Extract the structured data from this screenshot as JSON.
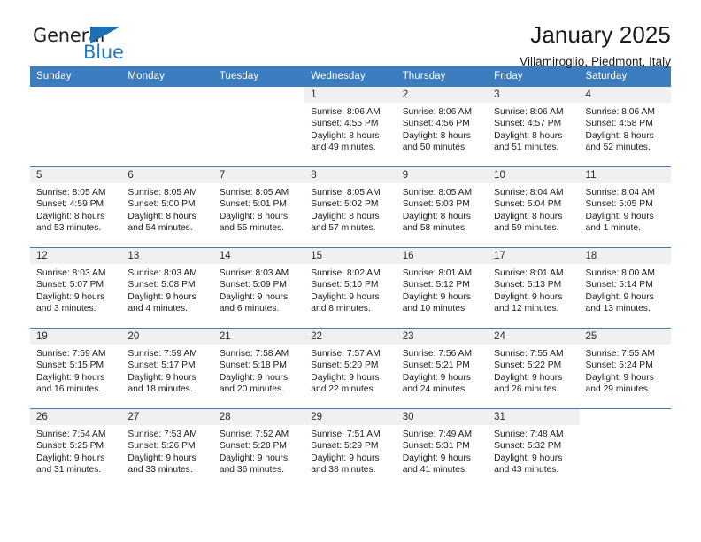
{
  "brand": {
    "name_dark": "General",
    "name_blue": "Blue",
    "accent_color": "#1f6fb5"
  },
  "header": {
    "title": "January 2025",
    "subtitle": "Villamiroglio, Piedmont, Italy"
  },
  "calendar": {
    "header_bg": "#3b7dbf",
    "daynum_bg": "#f0f0f0",
    "weekday_headers": [
      "Sunday",
      "Monday",
      "Tuesday",
      "Wednesday",
      "Thursday",
      "Friday",
      "Saturday"
    ],
    "weeks": [
      [
        {
          "day": "",
          "sunrise": "",
          "sunset": "",
          "daylight_1": "",
          "daylight_2": ""
        },
        {
          "day": "",
          "sunrise": "",
          "sunset": "",
          "daylight_1": "",
          "daylight_2": ""
        },
        {
          "day": "",
          "sunrise": "",
          "sunset": "",
          "daylight_1": "",
          "daylight_2": ""
        },
        {
          "day": "1",
          "sunrise": "Sunrise: 8:06 AM",
          "sunset": "Sunset: 4:55 PM",
          "daylight_1": "Daylight: 8 hours",
          "daylight_2": "and 49 minutes."
        },
        {
          "day": "2",
          "sunrise": "Sunrise: 8:06 AM",
          "sunset": "Sunset: 4:56 PM",
          "daylight_1": "Daylight: 8 hours",
          "daylight_2": "and 50 minutes."
        },
        {
          "day": "3",
          "sunrise": "Sunrise: 8:06 AM",
          "sunset": "Sunset: 4:57 PM",
          "daylight_1": "Daylight: 8 hours",
          "daylight_2": "and 51 minutes."
        },
        {
          "day": "4",
          "sunrise": "Sunrise: 8:06 AM",
          "sunset": "Sunset: 4:58 PM",
          "daylight_1": "Daylight: 8 hours",
          "daylight_2": "and 52 minutes."
        }
      ],
      [
        {
          "day": "5",
          "sunrise": "Sunrise: 8:05 AM",
          "sunset": "Sunset: 4:59 PM",
          "daylight_1": "Daylight: 8 hours",
          "daylight_2": "and 53 minutes."
        },
        {
          "day": "6",
          "sunrise": "Sunrise: 8:05 AM",
          "sunset": "Sunset: 5:00 PM",
          "daylight_1": "Daylight: 8 hours",
          "daylight_2": "and 54 minutes."
        },
        {
          "day": "7",
          "sunrise": "Sunrise: 8:05 AM",
          "sunset": "Sunset: 5:01 PM",
          "daylight_1": "Daylight: 8 hours",
          "daylight_2": "and 55 minutes."
        },
        {
          "day": "8",
          "sunrise": "Sunrise: 8:05 AM",
          "sunset": "Sunset: 5:02 PM",
          "daylight_1": "Daylight: 8 hours",
          "daylight_2": "and 57 minutes."
        },
        {
          "day": "9",
          "sunrise": "Sunrise: 8:05 AM",
          "sunset": "Sunset: 5:03 PM",
          "daylight_1": "Daylight: 8 hours",
          "daylight_2": "and 58 minutes."
        },
        {
          "day": "10",
          "sunrise": "Sunrise: 8:04 AM",
          "sunset": "Sunset: 5:04 PM",
          "daylight_1": "Daylight: 8 hours",
          "daylight_2": "and 59 minutes."
        },
        {
          "day": "11",
          "sunrise": "Sunrise: 8:04 AM",
          "sunset": "Sunset: 5:05 PM",
          "daylight_1": "Daylight: 9 hours",
          "daylight_2": "and 1 minute."
        }
      ],
      [
        {
          "day": "12",
          "sunrise": "Sunrise: 8:03 AM",
          "sunset": "Sunset: 5:07 PM",
          "daylight_1": "Daylight: 9 hours",
          "daylight_2": "and 3 minutes."
        },
        {
          "day": "13",
          "sunrise": "Sunrise: 8:03 AM",
          "sunset": "Sunset: 5:08 PM",
          "daylight_1": "Daylight: 9 hours",
          "daylight_2": "and 4 minutes."
        },
        {
          "day": "14",
          "sunrise": "Sunrise: 8:03 AM",
          "sunset": "Sunset: 5:09 PM",
          "daylight_1": "Daylight: 9 hours",
          "daylight_2": "and 6 minutes."
        },
        {
          "day": "15",
          "sunrise": "Sunrise: 8:02 AM",
          "sunset": "Sunset: 5:10 PM",
          "daylight_1": "Daylight: 9 hours",
          "daylight_2": "and 8 minutes."
        },
        {
          "day": "16",
          "sunrise": "Sunrise: 8:01 AM",
          "sunset": "Sunset: 5:12 PM",
          "daylight_1": "Daylight: 9 hours",
          "daylight_2": "and 10 minutes."
        },
        {
          "day": "17",
          "sunrise": "Sunrise: 8:01 AM",
          "sunset": "Sunset: 5:13 PM",
          "daylight_1": "Daylight: 9 hours",
          "daylight_2": "and 12 minutes."
        },
        {
          "day": "18",
          "sunrise": "Sunrise: 8:00 AM",
          "sunset": "Sunset: 5:14 PM",
          "daylight_1": "Daylight: 9 hours",
          "daylight_2": "and 13 minutes."
        }
      ],
      [
        {
          "day": "19",
          "sunrise": "Sunrise: 7:59 AM",
          "sunset": "Sunset: 5:15 PM",
          "daylight_1": "Daylight: 9 hours",
          "daylight_2": "and 16 minutes."
        },
        {
          "day": "20",
          "sunrise": "Sunrise: 7:59 AM",
          "sunset": "Sunset: 5:17 PM",
          "daylight_1": "Daylight: 9 hours",
          "daylight_2": "and 18 minutes."
        },
        {
          "day": "21",
          "sunrise": "Sunrise: 7:58 AM",
          "sunset": "Sunset: 5:18 PM",
          "daylight_1": "Daylight: 9 hours",
          "daylight_2": "and 20 minutes."
        },
        {
          "day": "22",
          "sunrise": "Sunrise: 7:57 AM",
          "sunset": "Sunset: 5:20 PM",
          "daylight_1": "Daylight: 9 hours",
          "daylight_2": "and 22 minutes."
        },
        {
          "day": "23",
          "sunrise": "Sunrise: 7:56 AM",
          "sunset": "Sunset: 5:21 PM",
          "daylight_1": "Daylight: 9 hours",
          "daylight_2": "and 24 minutes."
        },
        {
          "day": "24",
          "sunrise": "Sunrise: 7:55 AM",
          "sunset": "Sunset: 5:22 PM",
          "daylight_1": "Daylight: 9 hours",
          "daylight_2": "and 26 minutes."
        },
        {
          "day": "25",
          "sunrise": "Sunrise: 7:55 AM",
          "sunset": "Sunset: 5:24 PM",
          "daylight_1": "Daylight: 9 hours",
          "daylight_2": "and 29 minutes."
        }
      ],
      [
        {
          "day": "26",
          "sunrise": "Sunrise: 7:54 AM",
          "sunset": "Sunset: 5:25 PM",
          "daylight_1": "Daylight: 9 hours",
          "daylight_2": "and 31 minutes."
        },
        {
          "day": "27",
          "sunrise": "Sunrise: 7:53 AM",
          "sunset": "Sunset: 5:26 PM",
          "daylight_1": "Daylight: 9 hours",
          "daylight_2": "and 33 minutes."
        },
        {
          "day": "28",
          "sunrise": "Sunrise: 7:52 AM",
          "sunset": "Sunset: 5:28 PM",
          "daylight_1": "Daylight: 9 hours",
          "daylight_2": "and 36 minutes."
        },
        {
          "day": "29",
          "sunrise": "Sunrise: 7:51 AM",
          "sunset": "Sunset: 5:29 PM",
          "daylight_1": "Daylight: 9 hours",
          "daylight_2": "and 38 minutes."
        },
        {
          "day": "30",
          "sunrise": "Sunrise: 7:49 AM",
          "sunset": "Sunset: 5:31 PM",
          "daylight_1": "Daylight: 9 hours",
          "daylight_2": "and 41 minutes."
        },
        {
          "day": "31",
          "sunrise": "Sunrise: 7:48 AM",
          "sunset": "Sunset: 5:32 PM",
          "daylight_1": "Daylight: 9 hours",
          "daylight_2": "and 43 minutes."
        },
        {
          "day": "",
          "sunrise": "",
          "sunset": "",
          "daylight_1": "",
          "daylight_2": ""
        }
      ]
    ]
  }
}
